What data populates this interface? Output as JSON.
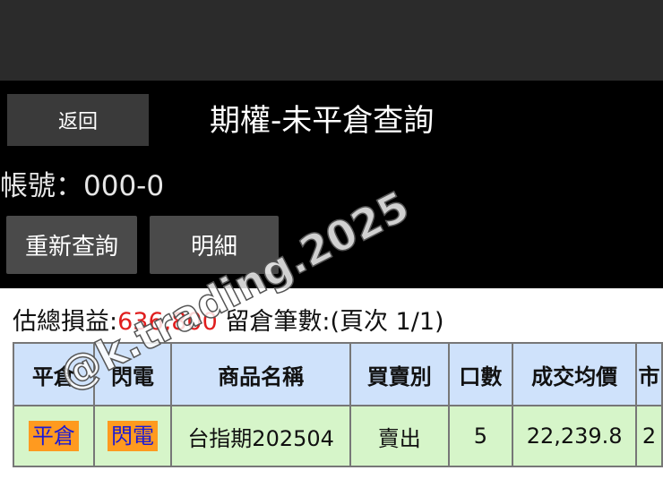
{
  "header": {
    "back_label": "返回",
    "title": "期權-未平倉查詢"
  },
  "account": {
    "text": "帳號：000-0"
  },
  "actions": {
    "requery_label": "重新查詢",
    "detail_label": "明細"
  },
  "summary": {
    "pl_label": "估總損益:",
    "pl_value": "636,800",
    "count_label": " 留倉筆數:(頁次 1/1)"
  },
  "table": {
    "columns": [
      "平倉",
      "閃電",
      "商品名稱",
      "買賣別",
      "口數",
      "成交均價",
      "市"
    ],
    "rows": [
      {
        "close": "平倉",
        "flash": "閃電",
        "product": "台指期202504",
        "side": "賣出",
        "qty": "5",
        "avg_price": "22,239.8",
        "market": "2"
      }
    ]
  },
  "watermark": "@k.trading.2025",
  "colors": {
    "pl_value": "#e01e1e",
    "header_bg": "#cfe2fb",
    "row_bg": "#d6f5c9",
    "chip_bg": "#ff9a1f",
    "sell_text": "#1d8a1d"
  }
}
